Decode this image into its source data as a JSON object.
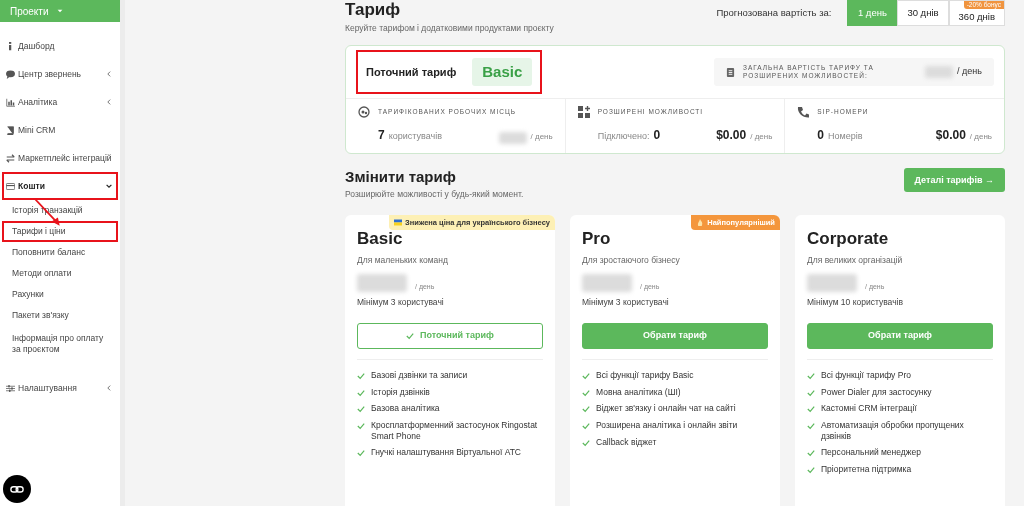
{
  "sidebar": {
    "project_menu": "Проекти",
    "items": [
      {
        "label": "Дашборд",
        "kind": "link",
        "highlighted": false
      },
      {
        "label": "Центр звернень",
        "kind": "group",
        "expanded": false,
        "highlighted": false
      },
      {
        "label": "Аналітика",
        "kind": "group",
        "expanded": false,
        "highlighted": false
      },
      {
        "label": "Mini CRM",
        "kind": "link",
        "highlighted": false
      },
      {
        "label": "Маркетплейс інтеграцій",
        "kind": "link",
        "highlighted": false
      },
      {
        "label": "Кошти",
        "kind": "group",
        "expanded": true,
        "highlighted": true,
        "children": [
          {
            "label": "Історія транзакцій",
            "highlighted": false
          },
          {
            "label": "Тарифи і ціни",
            "highlighted": true
          },
          {
            "label": "Поповнити баланс",
            "highlighted": false
          },
          {
            "label": "Методи оплати",
            "highlighted": false
          },
          {
            "label": "Рахунки",
            "highlighted": false
          },
          {
            "label": "Пакети зв'язку",
            "highlighted": false
          },
          {
            "label": "Інформація про оплату за проєктом",
            "highlighted": false
          }
        ]
      },
      {
        "label": "Налаштування",
        "kind": "group",
        "expanded": false,
        "highlighted": false
      }
    ]
  },
  "header": {
    "title": "Тариф",
    "subtitle": "Керуйте тарифом і додатковими продуктами проєкту",
    "forecast_label": "Прогнозована вартість за:",
    "periods": [
      {
        "label": "1 день",
        "selected": true
      },
      {
        "label": "30 днів",
        "selected": false
      },
      {
        "label": "360 днів",
        "selected": false,
        "badge": "-20% бонус"
      }
    ]
  },
  "current_plan": {
    "label": "Поточний тариф",
    "plan": "Basic",
    "highlighted": true,
    "total_label": "ЗАГАЛЬНА ВАРТІСТЬ ТАРИФУ ТА РОЗШИРЕНИХ МОЖЛИВОСТЕЙ:",
    "total_unit": "/ день",
    "stats": [
      {
        "label": "ТАРИФІКОВАНИХ РОБОЧИХ МІСЦЬ",
        "count": "7",
        "suffix": "користувачів",
        "unit": "/ день"
      },
      {
        "label": "РОЗШИРЕНІ МОЖЛИВОСТІ",
        "prefix": "Підключено:",
        "count": "0",
        "price": "$0.00",
        "unit": "/ день"
      },
      {
        "label": "SIP-НОМЕРИ",
        "count": "0",
        "suffix": "Номерів",
        "price": "$0.00",
        "unit": "/ день"
      }
    ]
  },
  "change": {
    "title": "Змінити тариф",
    "subtitle": "Розширюйте можливості у будь-який момент.",
    "details_button": "Деталі тарифів →",
    "plans": [
      {
        "name": "Basic",
        "tagline": "Для маленьких команд",
        "ribbon": {
          "kind": "flag",
          "text": "Знижена ціна для українського бізнесу"
        },
        "price_unit": "/ день",
        "minimum": "Мінімум 3 користувачі",
        "button": {
          "kind": "current",
          "label": "Поточний тариф"
        },
        "features": [
          "Базові дзвінки та записи",
          "Історія дзвінків",
          "Базова аналітика",
          "Кросплатформенний застосунок Ringostat Smart Phone",
          "Гнучкі налаштування Віртуальної АТС"
        ]
      },
      {
        "name": "Pro",
        "tagline": "Для зростаючого бізнесу",
        "ribbon": {
          "kind": "fire",
          "text": "Найпопулярніший"
        },
        "price_unit": "/ день",
        "minimum": "Мінімум 3 користувачі",
        "button": {
          "kind": "choose",
          "label": "Обрати тариф"
        },
        "features": [
          "Всі функції тарифу Basic",
          "Мовна аналітика (ШІ)",
          "Віджет зв'язку і онлайн чат на сайті",
          "Розширена аналітика і онлайн звіти",
          "Callback віджет"
        ]
      },
      {
        "name": "Corporate",
        "tagline": "Для великих організацій",
        "price_unit": "/ день",
        "minimum": "Мінімум 10 користувачів",
        "button": {
          "kind": "choose",
          "label": "Обрати тариф"
        },
        "features": [
          "Всі функції тарифу Pro",
          "Power Dialer для застосунку",
          "Кастомні CRM інтеграції",
          "Автоматизація обробки пропущених дзвінків",
          "Персональний менеджер",
          "Пріоритетна підтримка"
        ]
      }
    ]
  }
}
